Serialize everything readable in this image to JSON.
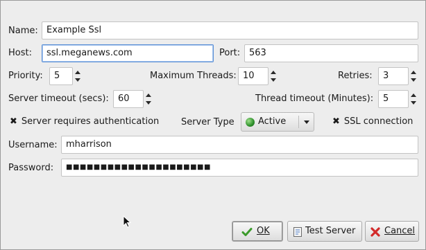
{
  "form": {
    "name_label": "Name:",
    "name_value": "Example Ssl",
    "host_label": "Host:",
    "host_value": "ssl.meganews.com",
    "port_label": "Port:",
    "port_value": "563",
    "priority_label": "Priority:",
    "priority_value": "5",
    "max_threads_label": "Maximum Threads:",
    "max_threads_value": "10",
    "retries_label": "Retries:",
    "retries_value": "3",
    "server_timeout_label": "Server timeout (secs):",
    "server_timeout_value": "60",
    "thread_timeout_label": "Thread timeout (Minutes):",
    "thread_timeout_value": "5",
    "auth_check_mark": "✖",
    "auth_label": "Server requires authentication",
    "server_type_label": "Server Type",
    "server_type_value": "Active",
    "ssl_check_mark": "✖",
    "ssl_label": "SSL connection",
    "username_label": "Username:",
    "username_value": "mharrison",
    "password_label": "Password:",
    "password_value": "■■■■■■■■■■■■■■■■■■■■■"
  },
  "buttons": {
    "ok_label": "OK",
    "test_label": "Test Server",
    "cancel_label": "Cancel"
  },
  "icons": {
    "ok": "checkmark-icon",
    "test": "document-icon",
    "cancel": "cancel-x-icon",
    "server_type": "globe-icon"
  },
  "colors": {
    "focus": "#5b8fd6",
    "ok_green": "#3a9a2a",
    "cancel_red": "#d22a2a"
  }
}
